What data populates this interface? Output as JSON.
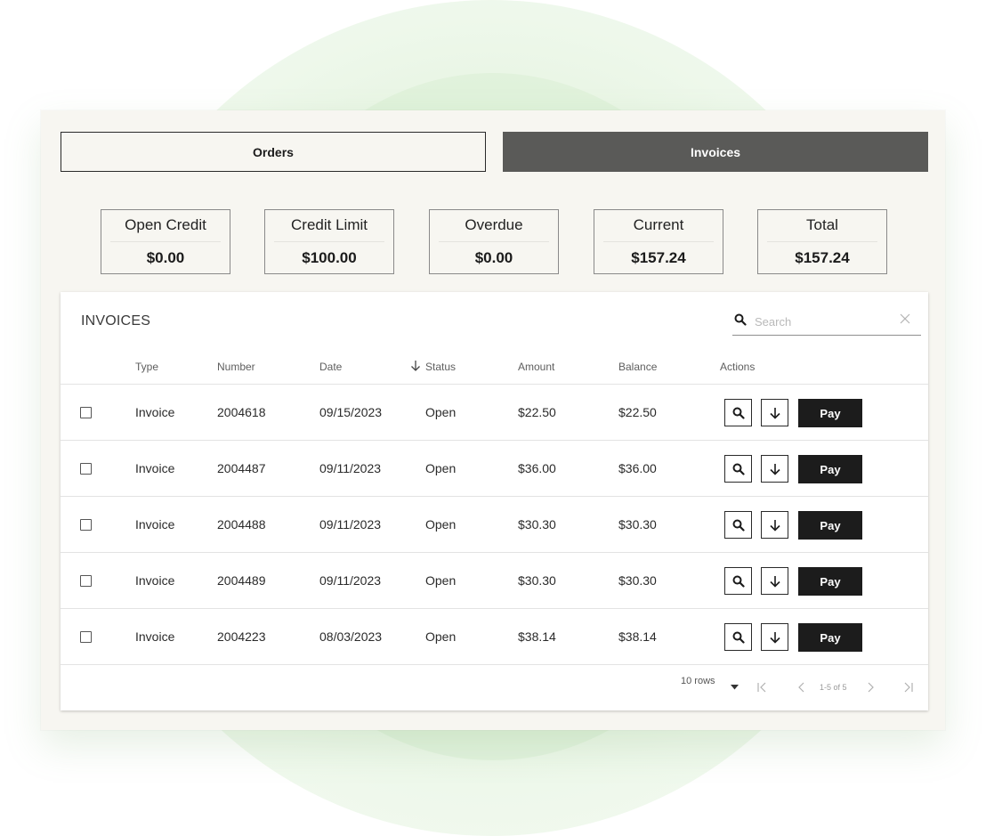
{
  "tabs": [
    {
      "label": "Orders",
      "active": false
    },
    {
      "label": "Invoices",
      "active": true
    }
  ],
  "summary": [
    {
      "label": "Open Credit",
      "value": "$0.00"
    },
    {
      "label": "Credit Limit",
      "value": "$100.00"
    },
    {
      "label": "Overdue",
      "value": "$0.00"
    },
    {
      "label": "Current",
      "value": "$157.24"
    },
    {
      "label": "Total",
      "value": "$157.24"
    }
  ],
  "invoices": {
    "title": "INVOICES",
    "search_placeholder": "Search",
    "columns": {
      "type": "Type",
      "number": "Number",
      "date": "Date",
      "status": "Status",
      "amount": "Amount",
      "balance": "Balance",
      "actions": "Actions"
    },
    "sort_column": "Date",
    "sort_direction": "descending",
    "pay_label": "Pay",
    "rows": [
      {
        "type": "Invoice",
        "number": "2004618",
        "date": "09/15/2023",
        "status": "Open",
        "amount": "$22.50",
        "balance": "$22.50"
      },
      {
        "type": "Invoice",
        "number": "2004487",
        "date": "09/11/2023",
        "status": "Open",
        "amount": "$36.00",
        "balance": "$36.00"
      },
      {
        "type": "Invoice",
        "number": "2004488",
        "date": "09/11/2023",
        "status": "Open",
        "amount": "$30.30",
        "balance": "$30.30"
      },
      {
        "type": "Invoice",
        "number": "2004489",
        "date": "09/11/2023",
        "status": "Open",
        "amount": "$30.30",
        "balance": "$30.30"
      },
      {
        "type": "Invoice",
        "number": "2004223",
        "date": "08/03/2023",
        "status": "Open",
        "amount": "$38.14",
        "balance": "$38.14"
      }
    ],
    "pagination": {
      "rows_per_page": "10 rows",
      "range": "1-5 of 5"
    }
  },
  "icons": {
    "search": "search-icon",
    "clear": "close-icon",
    "sort": "arrow-down-icon",
    "view": "magnifier-icon",
    "download": "download-arrow-icon",
    "first": "first-page-icon",
    "prev": "chevron-left-icon",
    "next": "chevron-right-icon",
    "last": "last-page-icon"
  },
  "colors": {
    "active_tab": "#5a5a58",
    "pay_button": "#1c1c1c",
    "panel_bg": "#f7f6f1",
    "glow": "#d9efd3"
  }
}
